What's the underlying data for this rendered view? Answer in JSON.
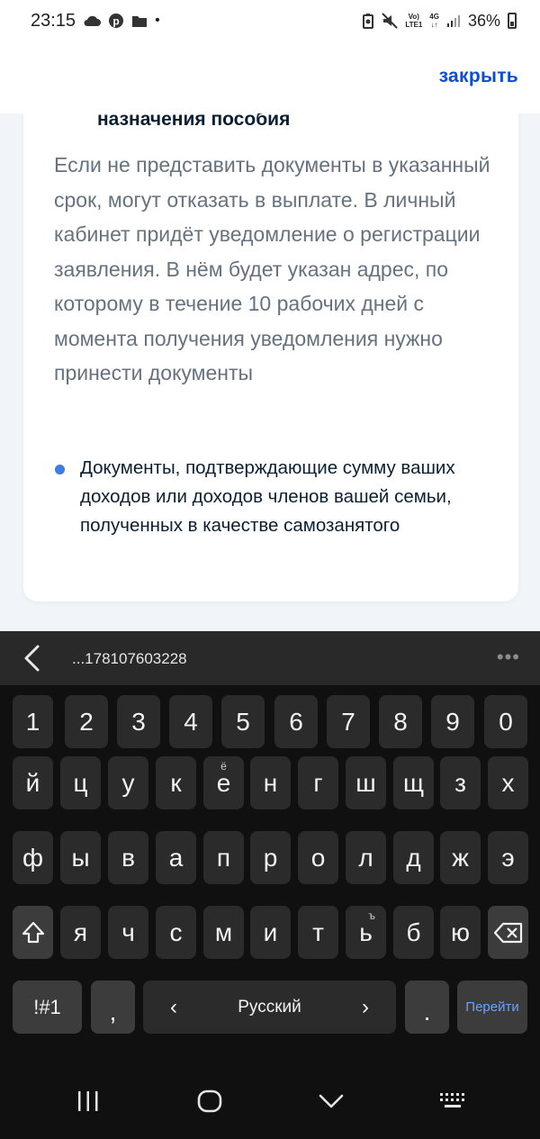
{
  "status_bar": {
    "time": "23:15",
    "network_top": "Vo)",
    "network_bottom": "LTE1",
    "data_top": "4G",
    "data_bottom": "↓↑",
    "battery": "36%"
  },
  "header": {
    "close_label": "закрыть"
  },
  "card": {
    "heading": "назначения пособия",
    "paragraph": "Если не представить документы в указанный срок, могут отказать в выплате. В личный кабинет придёт уведомление о регистрации заявления. В нём будет указан адрес, по которому в течение 10 рабочих дней с момента получения уведомления нужно принести документы",
    "bullet": " Документы, подтверждающие сумму ваших доходов или доходов членов вашей семьи, полученных в качестве самозанятого",
    "accent_color": "#3d7be5"
  },
  "keyboard": {
    "clipboard_text": "...178107603228",
    "number_row": [
      "1",
      "2",
      "3",
      "4",
      "5",
      "6",
      "7",
      "8",
      "9",
      "0"
    ],
    "row1": [
      "й",
      "ц",
      "у",
      "к",
      "е",
      "н",
      "г",
      "ш",
      "щ",
      "з",
      "х"
    ],
    "row1_alt_e": "ё",
    "row2": [
      "ф",
      "ы",
      "в",
      "а",
      "п",
      "р",
      "о",
      "л",
      "д",
      "ж",
      "э"
    ],
    "row3": [
      "я",
      "ч",
      "с",
      "м",
      "и",
      "т",
      "ь",
      "б",
      "ю"
    ],
    "row3_alt_soft": "ъ",
    "symbols_label": "!#1",
    "comma": ",",
    "language_label": "Русский",
    "lang_prev": "‹",
    "lang_next": "›",
    "period": ".",
    "go_label": "Перейти"
  },
  "colors": {
    "link": "#0d4cd3",
    "keyboard_bg": "#101010",
    "key_bg": "#2b2b2b"
  }
}
